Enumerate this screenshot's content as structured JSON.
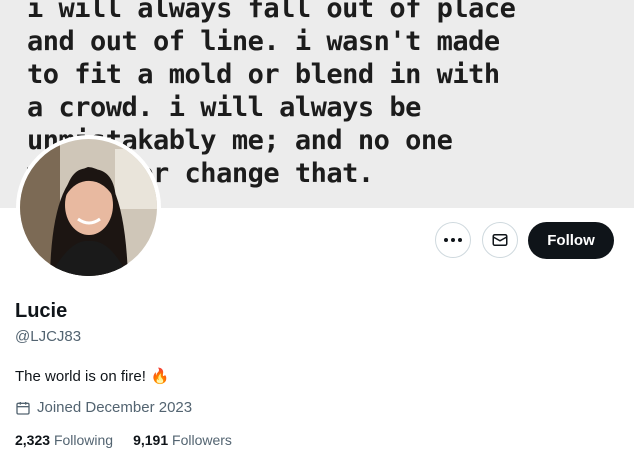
{
  "banner": {
    "quote_lines": [
      "i will always fall out of place",
      "and out of line. i wasn't made",
      "to fit a mold or blend in with",
      "a crowd. i will always be",
      "unmistakably me; and no one",
      "will ever change that."
    ]
  },
  "profile": {
    "name": "Lucie",
    "handle": "@LJCJ83",
    "bio": "The world is on fire!",
    "bio_emoji": "🔥",
    "joined": "Joined December 2023",
    "following_count": "2,323",
    "following_label": "Following",
    "followers_count": "9,191",
    "followers_label": "Followers"
  },
  "actions": {
    "follow_label": "Follow",
    "more_icon": "more-horizontal-icon",
    "message_icon": "envelope-icon"
  },
  "colors": {
    "text_primary": "#0f1419",
    "text_secondary": "#536471",
    "follow_bg": "#0f1419",
    "border": "#cfd9de"
  }
}
